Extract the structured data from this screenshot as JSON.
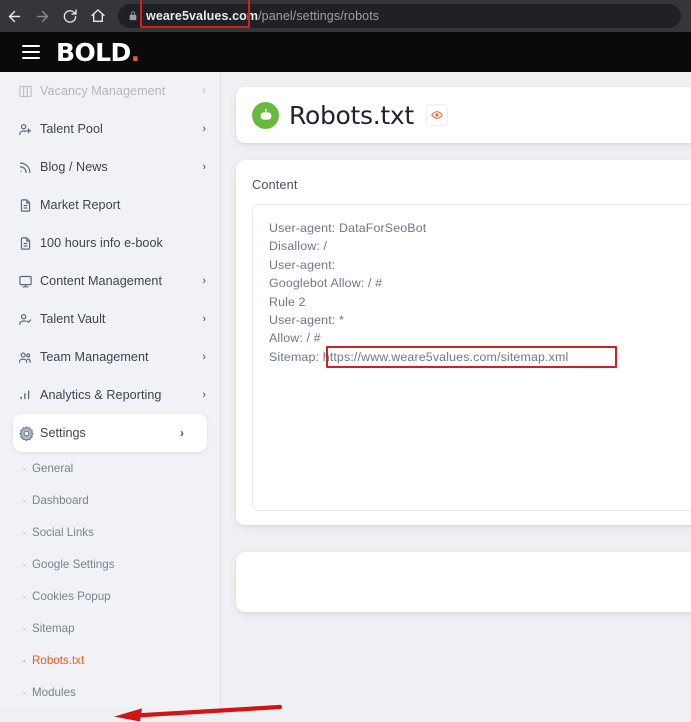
{
  "browser": {
    "back_icon": "arrow-left-icon",
    "forward_icon": "arrow-right-icon",
    "reload_icon": "reload-icon",
    "home_icon": "home-icon",
    "lock_icon": "lock-icon",
    "url_domain": "weare5values.com",
    "url_path": "/panel/settings/robots"
  },
  "header": {
    "menu_icon": "hamburger-menu-icon",
    "brand": "BOLD",
    "brand_dot": "."
  },
  "sidebar": {
    "items": [
      {
        "label": "Vacancy Management",
        "icon": "grid-columns-icon",
        "chevron": "›",
        "faded": true
      },
      {
        "label": "Talent Pool",
        "icon": "person-plus-icon",
        "chevron": "›"
      },
      {
        "label": "Blog / News",
        "icon": "rss-icon",
        "chevron": "›"
      },
      {
        "label": "Market Report",
        "icon": "document-icon",
        "chevron": ""
      },
      {
        "label": "100 hours info e-book",
        "icon": "document-icon",
        "chevron": ""
      },
      {
        "label": "Content Management",
        "icon": "monitor-icon",
        "chevron": "›"
      },
      {
        "label": "Talent Vault",
        "icon": "person-check-icon",
        "chevron": "›"
      },
      {
        "label": "Team Management",
        "icon": "people-icon",
        "chevron": "›"
      },
      {
        "label": "Analytics & Reporting",
        "icon": "bar-chart-icon",
        "chevron": "›"
      },
      {
        "label": "Settings",
        "icon": "gear-icon",
        "chevron": "›",
        "active": true
      }
    ],
    "sub_items": [
      {
        "label": "General",
        "bullet": "·"
      },
      {
        "label": "Dashboard",
        "bullet": "·"
      },
      {
        "label": "Social Links",
        "bullet": "·"
      },
      {
        "label": "Google Settings",
        "bullet": "·"
      },
      {
        "label": "Cookies Popup",
        "bullet": "·"
      },
      {
        "label": "Sitemap",
        "bullet": "·"
      },
      {
        "label": "Robots.txt",
        "bullet": "·",
        "current": true
      },
      {
        "label": "Modules",
        "bullet": "·"
      }
    ]
  },
  "main": {
    "avatar_icon": "robot-icon",
    "title": "Robots.txt",
    "preview_icon": "eye-icon",
    "content_label": "Content",
    "content_lines": [
      "User-agent: DataForSeoBot",
      "Disallow: /",
      "User-agent:",
      "Googlebot Allow: / #",
      "Rule 2",
      "User-agent: *",
      "Allow: / #"
    ],
    "sitemap_prefix": "Sitemap: ",
    "sitemap_url": "https://www.weare5values.com/sitemap.xml"
  },
  "annotations": {
    "url_box_color": "#d31f1f",
    "sitemap_box_color": "#cc2222",
    "arrow_color": "#d31414",
    "arrow_target": "Robots.txt"
  },
  "colors": {
    "brand_accent": "#f05a28",
    "active_nav": "#ef5a24",
    "robot_avatar_bg": "#6ab93f",
    "page_bg": "#eef0f3",
    "sidebar_bg": "#f1f2f5",
    "header_bg": "#0a0a0a",
    "chrome_bg": "#35363a"
  }
}
